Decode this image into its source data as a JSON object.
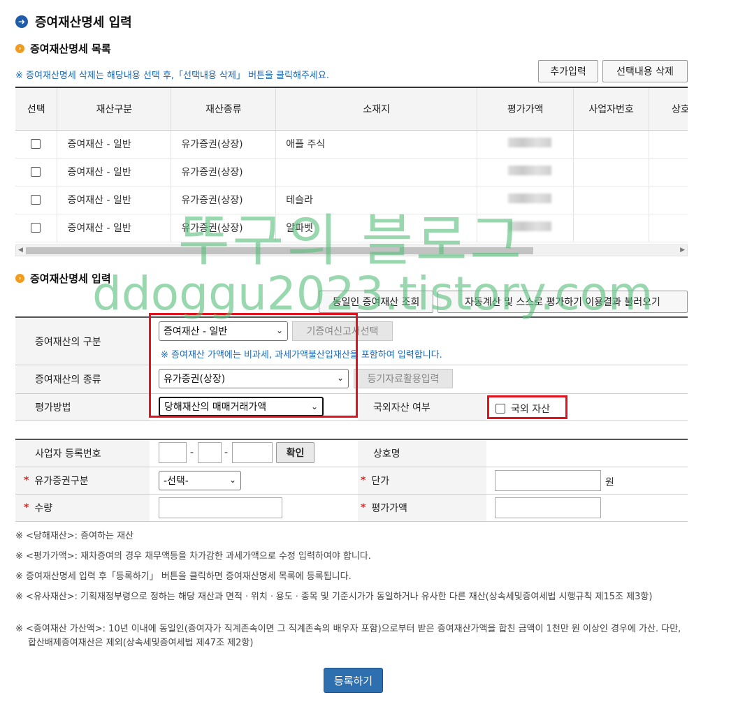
{
  "page": {
    "title": "증여재산명세 입력"
  },
  "list_section": {
    "title": "증여재산명세 목록",
    "notice": "※ 증여재산명세 삭제는 해당내용 선택 후,「선택내용 삭제」 버튼을 클릭해주세요.",
    "add_button": "추가입력",
    "delete_button": "선택내용 삭제",
    "columns": [
      "선택",
      "재산구분",
      "재산종류",
      "소재지",
      "평가가액",
      "사업자번호",
      "상호"
    ],
    "rows": [
      {
        "category": "증여재산 - 일반",
        "kind": "유가증권(상장)",
        "location": "애플 주식"
      },
      {
        "category": "증여재산 - 일반",
        "kind": "유가증권(상장)",
        "location": ""
      },
      {
        "category": "증여재산 - 일반",
        "kind": "유가증권(상장)",
        "location": "테슬라"
      },
      {
        "category": "증여재산 - 일반",
        "kind": "유가증권(상장)",
        "location": "알파벳"
      }
    ]
  },
  "input_section": {
    "title": "증여재산명세 입력",
    "same_person_button": "동일인 증여재산 조회",
    "auto_calc_button": "자동계산 및 스스로 평가하기 이용결과 불러오기",
    "labels": {
      "category": "증여재산의 구분",
      "kind": "증여재산의 종류",
      "method": "평가방법",
      "foreign": "국외자산 여부",
      "biz_no": "사업자 등록번호",
      "company": "상호명",
      "security_type": "유가증권구분",
      "unit_price": "단가",
      "quantity": "수량",
      "value": "평가가액"
    },
    "category_value": "증여재산 - 일반",
    "prev_report_button": "기증여신고서선택",
    "category_notice": "※ 증여재산 가액에는 비과세, 과세가액불산입재산을 포함하여 입력합니다.",
    "kind_value": "유가증권(상장)",
    "registry_button": "등기자료활용입력",
    "method_value": "당해재산의 매매거래가액",
    "foreign_checkbox": "국외 자산",
    "confirm_button": "확인",
    "security_type_value": "-선택-",
    "unit": "원",
    "dash": "-"
  },
  "notes": [
    "※ <당해재산>: 증여하는 재산",
    "※ <평가가액>: 재차증여의 경우 채무액등을 차가감한 과세가액으로 수정 입력하여야 합니다.",
    "※ 증여재산명세 입력 후「등록하기」 버튼을 클릭하면 증여재산명세 목록에 등록됩니다.",
    "※ <유사재산>: 기획재정부령으로 정하는 해당 재산과 면적ㆍ위치ㆍ용도ㆍ종목 및 기준시가가 동일하거나 유사한 다른 재산(상속세및증여세법 시행규칙 제15조 제3항)",
    "※ <증여재산 가산액>: 10년 이내에 동일인(증여자가 직계존속이면 그 직계존속의 배우자 포함)으로부터 받은 증여재산가액을 합친 금액이 1천만 원 이상인 경우에 가산. 다만, 합산배제증여재산은 제외(상속세및증여세법 제47조 제2항)"
  ],
  "submit_button": "등록하기",
  "watermark": {
    "line1": "뚜구의 블로그",
    "line2": "ddoggu2023.tistory.com"
  },
  "colors": {
    "accent": "#1e5ca8",
    "highlight": "#e0141f",
    "notice": "#1c69b7"
  }
}
